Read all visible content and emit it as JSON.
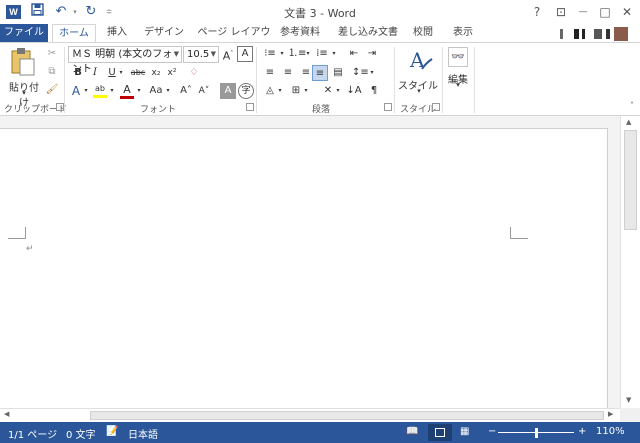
{
  "titlebar": {
    "app_logo": "W",
    "title": "文書 3 - Word",
    "help": "?",
    "restore_ribbon": "⊡",
    "minimize": "—",
    "maximize": "□",
    "close": "✕"
  },
  "tabs": {
    "file": "ファイル",
    "home": "ホーム",
    "insert": "挿入",
    "design": "デザイン",
    "layout": "ページ レイアウト",
    "references": "参考資料",
    "mailings": "差し込み文書",
    "review": "校閲",
    "view": "表示"
  },
  "ribbon": {
    "clipboard": {
      "paste_label": "貼り付け",
      "group_label": "クリップボード"
    },
    "font": {
      "font_name": "ＭＳ 明朝 (本文のフォント",
      "font_size": "10.5",
      "group_label": "フォント",
      "bold": "B",
      "italic": "I",
      "underline": "U",
      "strike": "abc",
      "subscript": "x₂",
      "superscript": "x²",
      "case": "Aa",
      "grow": "A˄",
      "shrink": "A˅"
    },
    "paragraph": {
      "group_label": "段落"
    },
    "styles": {
      "styles_label": "スタイル",
      "group_label": "スタイル"
    },
    "editing": {
      "edit_label": "編集"
    }
  },
  "document": {
    "paragraph_mark": "↵"
  },
  "statusbar": {
    "page": "1/1 ページ",
    "words": "0 文字",
    "language": "日本語",
    "zoom": "110%",
    "zoom_out": "−",
    "zoom_in": "+"
  },
  "colors": {
    "accent": "#2b579a",
    "highlight": "#ffff00",
    "font_color": "#c00000"
  }
}
